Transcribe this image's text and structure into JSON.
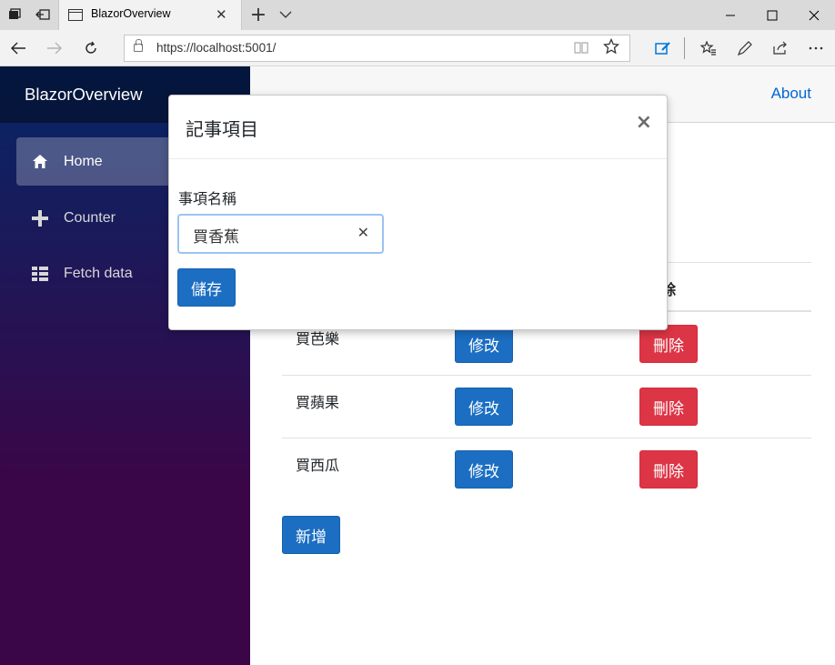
{
  "browser": {
    "tab_title": "BlazorOverview",
    "tab_close": "✕",
    "new_tab": "+",
    "tab_list": "⌄",
    "url": "https://localhost:5001/"
  },
  "sidebar": {
    "brand": "BlazorOverview",
    "items": [
      {
        "label": "Home",
        "icon": "home-icon"
      },
      {
        "label": "Counter",
        "icon": "plus-icon"
      },
      {
        "label": "Fetch data",
        "icon": "list-icon"
      }
    ]
  },
  "topbar": {
    "about": "About"
  },
  "table": {
    "header_fragment": "除",
    "rows": [
      {
        "name": "買芭樂",
        "edit": "修改",
        "delete": "刪除"
      },
      {
        "name": "買蘋果",
        "edit": "修改",
        "delete": "刪除"
      },
      {
        "name": "買西瓜",
        "edit": "修改",
        "delete": "刪除"
      }
    ],
    "add_label": "新增"
  },
  "modal": {
    "title": "記事項目",
    "close": "×",
    "field_label": "事項名稱",
    "input_value": "買香蕉",
    "clear": "✕",
    "save": "儲存"
  }
}
